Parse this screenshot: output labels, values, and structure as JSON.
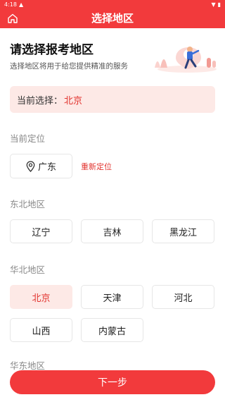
{
  "status_bar": {
    "time": "4:18",
    "battery_icon": "battery-icon",
    "wifi_icon": "wifi-icon"
  },
  "header": {
    "title": "选择地区",
    "home_icon": "home-icon"
  },
  "hero": {
    "title": "请选择报考地区",
    "subtitle": "选择地区将用于给您提供精准的服务"
  },
  "current": {
    "label": "当前选择：",
    "value": "北京"
  },
  "location": {
    "section_title": "当前定位",
    "city": "广东",
    "relocate_label": "重新定位"
  },
  "regions": [
    {
      "title": "东北地区",
      "items": [
        "辽宁",
        "吉林",
        "黑龙江"
      ]
    },
    {
      "title": "华北地区",
      "items": [
        "北京",
        "天津",
        "河北",
        "山西",
        "内蒙古"
      ]
    }
  ],
  "selected": "北京",
  "next_section_partial": "华东地区",
  "next_button": "下一步",
  "colors": {
    "accent": "#f23a3c",
    "selected_bg": "#fde9e6",
    "selected_text": "#e2342f"
  }
}
